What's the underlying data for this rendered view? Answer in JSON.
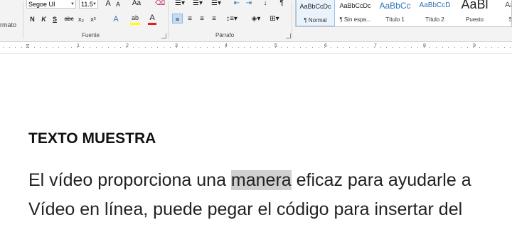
{
  "ribbon": {
    "clipboard_label_partial": "rmato",
    "font": {
      "name": "Segoe UI",
      "size": "11.5",
      "group_label": "Fuente",
      "grow": "A",
      "shrink": "A",
      "case": "Aa",
      "bold": "N",
      "italic": "K",
      "underline": "S",
      "strike": "abc",
      "subscript": "x₂",
      "superscript": "x²",
      "effects": "A",
      "highlight": "ab",
      "color": "A"
    },
    "paragraph": {
      "group_label": "Párrafo",
      "sort": "↓",
      "pilcrow": "¶"
    },
    "styles": [
      {
        "sample": "AaBbCcDc",
        "name": "¶ Normal",
        "selected": true
      },
      {
        "sample": "AaBbCcDc",
        "name": "¶ Sin espa...",
        "selected": false
      },
      {
        "sample": "AaBbCc",
        "name": "Título 1",
        "selected": false
      },
      {
        "sample": "AaBbCcD",
        "name": "Título 2",
        "selected": false
      },
      {
        "sample": "AaBl",
        "name": "Puesto",
        "selected": false
      },
      {
        "sample": "AaBb",
        "name": "Subt",
        "selected": false
      }
    ]
  },
  "ruler": {
    "numbers": [
      "1",
      "1",
      "2",
      "3",
      "4",
      "5",
      "6",
      "7",
      "8",
      "9"
    ]
  },
  "document": {
    "heading": "TEXTO MUESTRA",
    "line1_before": "El vídeo proporciona una ",
    "line1_selected": "manera",
    "line1_after": " eficaz para ayudarle a",
    "line2": "Vídeo en línea, puede pegar el código para insertar del"
  },
  "colors": {
    "ribbon_bg": "#f3f3f3",
    "selection_highlight": "#d0d0d0",
    "active_button": "#c5dcf3",
    "heading_blue": "#2e74b5",
    "font_color_red": "#e02020",
    "highlight_yellow": "#ffff00"
  }
}
